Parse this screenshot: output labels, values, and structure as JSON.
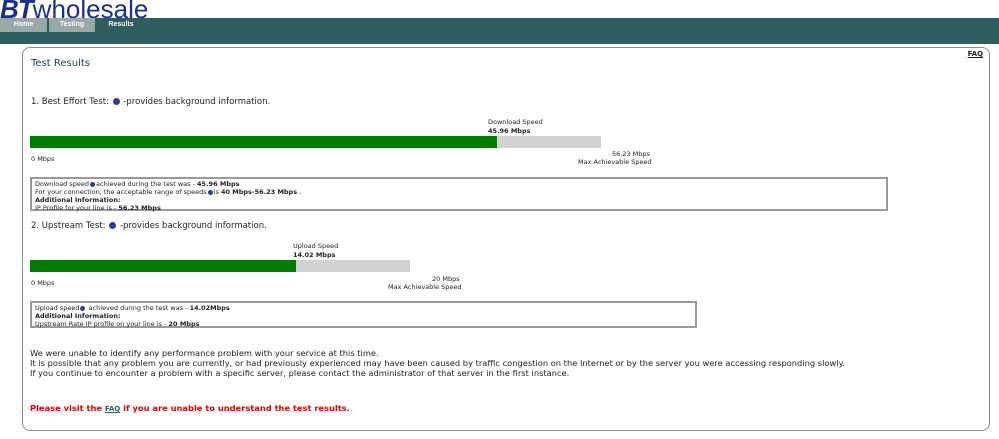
{
  "brand": {
    "bt": "BT",
    "wholesale": "wholesale"
  },
  "nav": {
    "tabs": [
      {
        "label": "Home"
      },
      {
        "label": "Testing"
      },
      {
        "label": "Results"
      }
    ]
  },
  "faq_link": "FAQ",
  "page_title": "Test Results",
  "download": {
    "heading_prefix": "1. Best Effort Test:",
    "heading_suffix": "-provides background information.",
    "speed_label": "Download Speed",
    "speed_value": "45.96 Mbps",
    "fill_fraction": 0.817,
    "min_label": "0 Mbps",
    "max_value": "56.23 Mbps",
    "max_label": "Max Achievable Speed",
    "info": {
      "line1_prefix": "Download speed",
      "line1_mid": "achieved during the test was - ",
      "line1_value": "45.96 Mbps",
      "line2_prefix": "For your connection, the acceptable range of speeds",
      "line2_mid": "is ",
      "line2_value": "40 Mbps-56.23 Mbps",
      "line2_end": " .",
      "additional": "Additional Information:",
      "line4_prefix": "IP Profile for your line is - ",
      "line4_value": "56.23 Mbps"
    }
  },
  "upload": {
    "heading_prefix": "2. Upstream Test:",
    "heading_suffix": "-provides background information.",
    "speed_label": "Upload Speed",
    "speed_value": "14.02 Mbps",
    "fill_fraction": 0.701,
    "min_label": "0 Mbps",
    "max_value": "20 Mbps",
    "max_label": "Max Achievable Speed",
    "info": {
      "line1_prefix": "Upload speed",
      "line1_mid": " achieved during the test was - ",
      "line1_value": "14.02Mbps",
      "additional": "Additional Information:",
      "line3_prefix": "Upstream Rate IP profile on your line is - ",
      "line3_value": "20 Mbps"
    }
  },
  "messages": [
    "We were unable to identify any performance problem with your service at this time.",
    "It is possible that any problem you are currently, or had previously experienced may have been caused by traffic congestion on the Internet or by the server you were accessing responding slowly.",
    "If you continue to encounter a problem with a specific server, please contact the administrator of that server in the first instance."
  ],
  "footer": {
    "prefix": "Please visit the ",
    "link": "FAQ",
    "suffix": " if you are unable to understand the test results."
  },
  "colors": {
    "bar_fill": "#007d00",
    "bar_bg": "#d2d2d2",
    "nav": "#2e5e5e",
    "alert": "#e00000"
  }
}
